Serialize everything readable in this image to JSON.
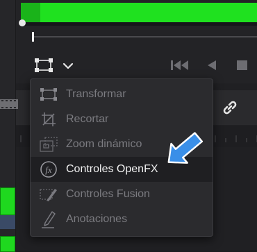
{
  "viewer": {
    "tools": {
      "transform_icon": "transform-rect-icon",
      "dropdown_icon": "chevron-down-icon"
    },
    "transport": {
      "skip_back_icon": "skip-to-start-icon",
      "prev_icon": "play-reverse-icon",
      "stop_icon": "stop-icon"
    }
  },
  "tool_menu": {
    "items": [
      {
        "label": "Transformar",
        "icon": "transform-icon",
        "active": false
      },
      {
        "label": "Recortar",
        "icon": "crop-icon",
        "active": false
      },
      {
        "label": "Zoom dinámico",
        "icon": "dynamic-zoom-icon",
        "active": false
      },
      {
        "label": "Controles OpenFX",
        "icon": "openfx-icon",
        "active": true
      },
      {
        "label": "Controles Fusion",
        "icon": "fusion-icon",
        "active": false
      },
      {
        "label": "Anotaciones",
        "icon": "pen-annotation-icon",
        "active": false
      }
    ]
  },
  "colors": {
    "accent_green": "#1fe11f",
    "callout_blue": "#3a8fe8",
    "menu_bg": "#2b2b2e",
    "active_text": "#f2f2f2",
    "inactive_text": "#7b7b80"
  }
}
